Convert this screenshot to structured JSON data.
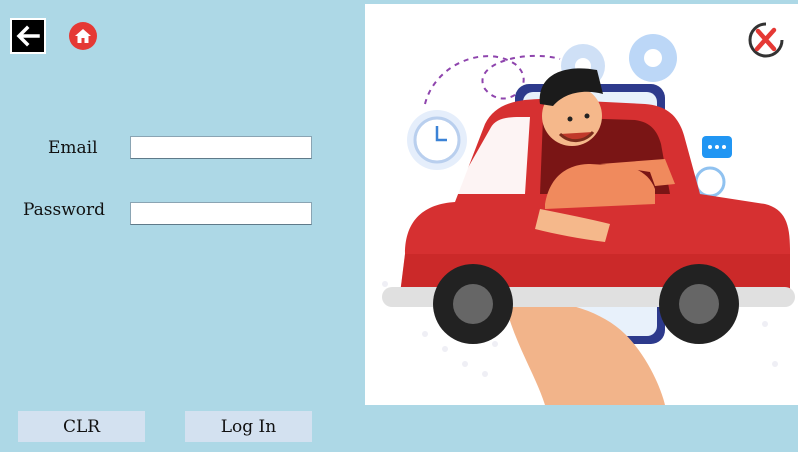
{
  "icons": {
    "back": "arrow-left-icon",
    "home": "home-icon",
    "close": "close-icon"
  },
  "form": {
    "email_label": "Email",
    "email_value": "",
    "password_label": "Password",
    "password_value": ""
  },
  "buttons": {
    "clear_label": "CLR",
    "login_label": "Log In"
  },
  "colors": {
    "background": "#add8e6",
    "button": "#d3e1f0",
    "accent_red": "#d63031"
  }
}
